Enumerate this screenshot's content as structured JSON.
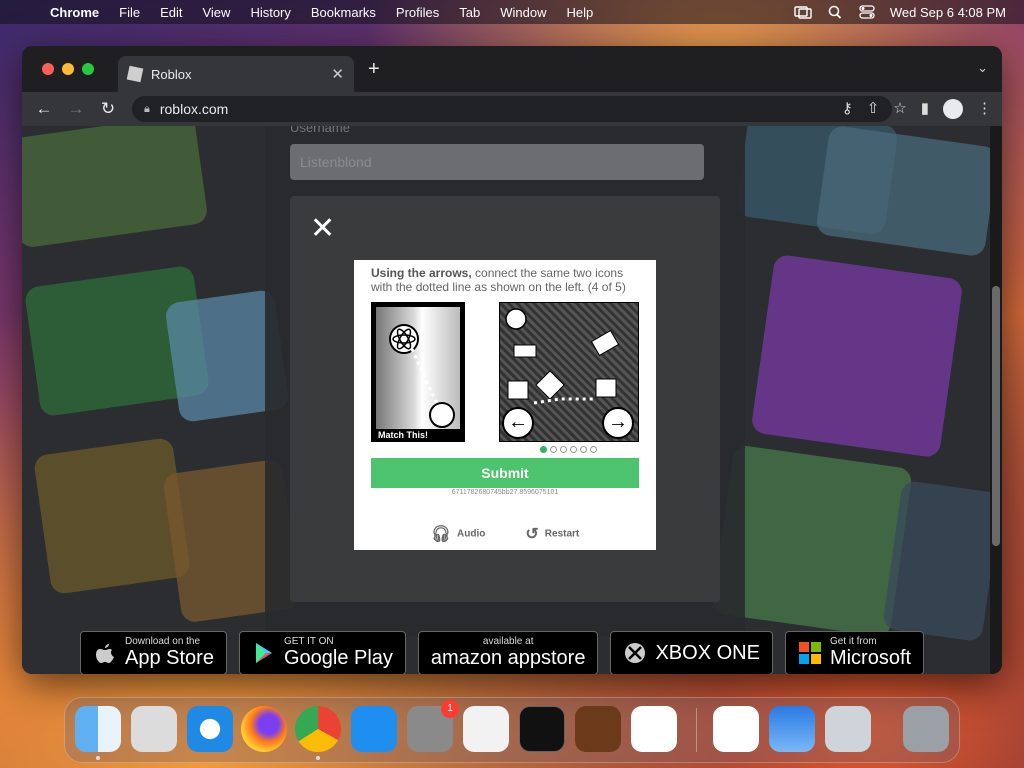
{
  "menubar": {
    "app": "Chrome",
    "items": [
      "File",
      "Edit",
      "View",
      "History",
      "Bookmarks",
      "Profiles",
      "Tab",
      "Window",
      "Help"
    ],
    "clock": "Wed Sep 6  4:08 PM"
  },
  "browser": {
    "tab_title": "Roblox",
    "url": "roblox.com"
  },
  "login": {
    "username_label": "Username",
    "username_value": "Listenblond"
  },
  "captcha": {
    "instruction_bold": "Using the arrows,",
    "instruction_rest": " connect the same two icons with the dotted line as shown on the left. (4 of 5)",
    "match_label": "Match This!",
    "progress_current": 1,
    "progress_total": 6,
    "submit_label": "Submit",
    "session_id": "6711782680745bb27.8596075101",
    "audio_label": "Audio",
    "restart_label": "Restart"
  },
  "store_badges": [
    {
      "small": "Download on the",
      "big": "App Store"
    },
    {
      "small": "GET IT ON",
      "big": "Google Play"
    },
    {
      "small": "available at",
      "big": "amazon appstore"
    },
    {
      "small": "",
      "big": "XBOX ONE"
    },
    {
      "small": "Get it from",
      "big": "Microsoft"
    }
  ],
  "dock": {
    "apps": [
      "finder",
      "launchpad",
      "safari",
      "firefox",
      "chrome",
      "app-store",
      "system-settings",
      "textedit",
      "terminal",
      "garageband",
      "vscode",
      "visual-studio",
      "weather",
      "disk-utility",
      "trash"
    ],
    "system_settings_badge": "1"
  }
}
